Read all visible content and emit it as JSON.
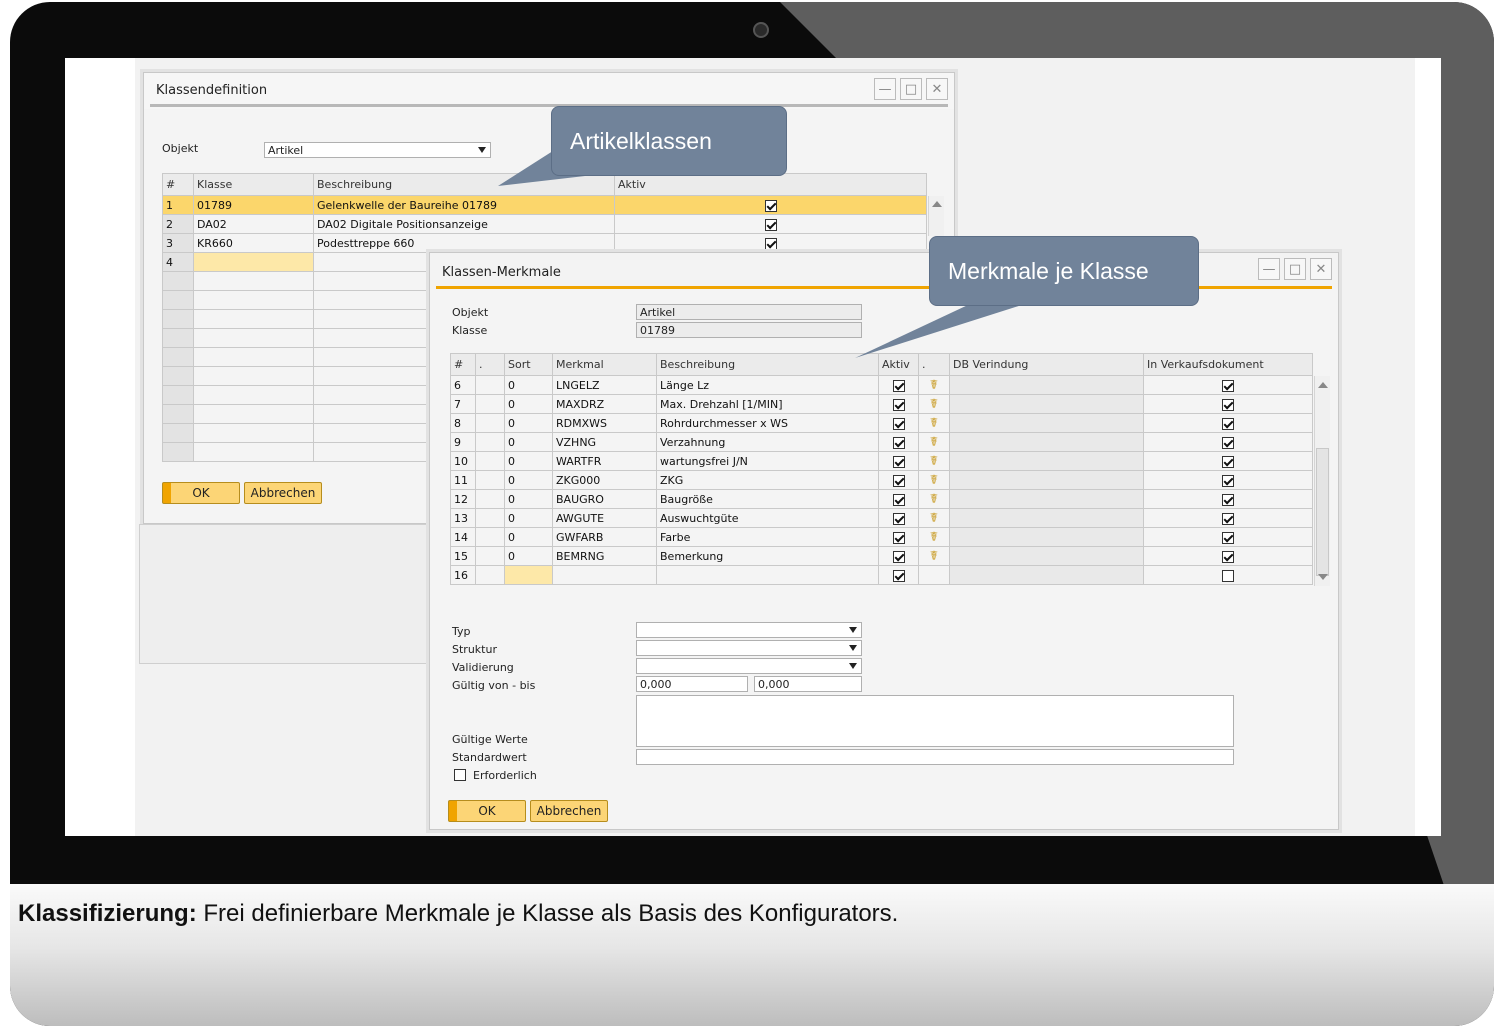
{
  "caption": {
    "bold": "Klassifizierung:",
    "text": " Frei definierbare Merkmale je Klasse als Basis des Konfigurators."
  },
  "callouts": {
    "artikelklassen": "Artikelklassen",
    "merkmale": "Merkmale je Klasse"
  },
  "klassendefinition": {
    "title": "Klassendefinition",
    "objekt_label": "Objekt",
    "objekt_value": "Artikel",
    "columns": [
      "#",
      "Klasse",
      "Beschreibung",
      "Aktiv"
    ],
    "rows": [
      {
        "n": "1",
        "klasse": "01789",
        "beschreibung": "Gelenkwelle der Baureihe 01789"
      },
      {
        "n": "2",
        "klasse": "DA02",
        "beschreibung": "DA02 Digitale Positionsanzeige"
      },
      {
        "n": "3",
        "klasse": "KR660",
        "beschreibung": "Podesttreppe 660"
      },
      {
        "n": "4",
        "klasse": "",
        "beschreibung": ""
      }
    ],
    "ok": "OK",
    "cancel": "Abbrechen"
  },
  "klassen_merkmale": {
    "title": "Klassen-Merkmale",
    "objekt_label": "Objekt",
    "objekt_value": "Artikel",
    "klasse_label": "Klasse",
    "klasse_value": "01789",
    "columns": [
      "#",
      ".",
      "Sort",
      "Merkmal",
      "Beschreibung",
      "Aktiv",
      ".",
      "DB Verindung",
      "In Verkaufsdokument"
    ],
    "rows": [
      {
        "n": "6",
        "sort": "0",
        "merkmal": "LNGELZ",
        "beschreibung": "Länge Lz"
      },
      {
        "n": "7",
        "sort": "0",
        "merkmal": "MAXDRZ",
        "beschreibung": "Max. Drehzahl [1/MIN]"
      },
      {
        "n": "8",
        "sort": "0",
        "merkmal": "RDMXWS",
        "beschreibung": "Rohrdurchmesser x WS"
      },
      {
        "n": "9",
        "sort": "0",
        "merkmal": "VZHNG",
        "beschreibung": "Verzahnung"
      },
      {
        "n": "10",
        "sort": "0",
        "merkmal": "WARTFR",
        "beschreibung": "wartungsfrei J/N"
      },
      {
        "n": "11",
        "sort": "0",
        "merkmal": "ZKG000",
        "beschreibung": "ZKG"
      },
      {
        "n": "12",
        "sort": "0",
        "merkmal": "BAUGRO",
        "beschreibung": "Baugröße"
      },
      {
        "n": "13",
        "sort": "0",
        "merkmal": "AWGUTE",
        "beschreibung": "Auswuchtgüte"
      },
      {
        "n": "14",
        "sort": "0",
        "merkmal": "GWFARB",
        "beschreibung": "Farbe"
      },
      {
        "n": "15",
        "sort": "0",
        "merkmal": "BEMRNG",
        "beschreibung": "Bemerkung"
      },
      {
        "n": "16",
        "sort": "",
        "merkmal": "",
        "beschreibung": ""
      }
    ],
    "typ_label": "Typ",
    "struktur_label": "Struktur",
    "validierung_label": "Validierung",
    "gueltig_label": "Gültig von - bis",
    "gueltig_von": "0,000",
    "gueltig_bis": "0,000",
    "gueltige_werte_label": "Gültige Werte",
    "standardwert_label": "Standardwert",
    "erforderlich_label": "Erforderlich",
    "ok": "OK",
    "cancel": "Abbrechen"
  },
  "colors": {
    "accent": "#f0a400",
    "selection": "#fbd66b",
    "callout": "#71839a"
  },
  "icons": {
    "frame_corner": "laptop-bezel",
    "row_link": "chain-link-icon"
  }
}
